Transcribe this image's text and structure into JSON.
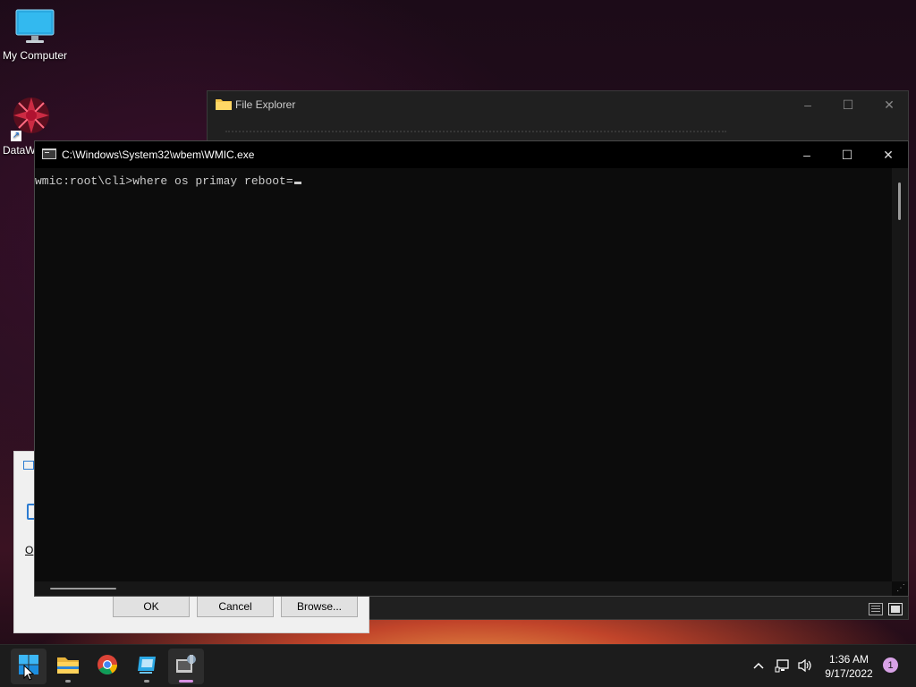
{
  "desktop": {
    "icons": [
      {
        "label": "My Computer",
        "icon": "monitor-icon"
      },
      {
        "label": "DataW",
        "icon": "datawave-app-icon"
      }
    ]
  },
  "file_explorer": {
    "title": "File Explorer",
    "controls": {
      "minimize": "–",
      "maximize": "☐",
      "close": "✕"
    }
  },
  "dialog": {
    "partial_text": "O",
    "buttons": {
      "ok": "OK",
      "cancel": "Cancel",
      "browse": "Browse..."
    }
  },
  "console": {
    "title": "C:\\Windows\\System32\\wbem\\WMIC.exe",
    "controls": {
      "minimize": "–",
      "maximize": "☐",
      "close": "✕"
    },
    "prompt": "wmic:root\\cli>",
    "command": "where os primay reboot="
  },
  "taskbar": {
    "apps": [
      {
        "name": "start",
        "icon": "windows-start-icon"
      },
      {
        "name": "file-explorer",
        "icon": "folder-icon"
      },
      {
        "name": "chrome",
        "icon": "chrome-icon"
      },
      {
        "name": "app",
        "icon": "remote-app-icon"
      },
      {
        "name": "wmic",
        "icon": "wmic-console-icon"
      }
    ],
    "clock": {
      "time": "1:36 AM",
      "date": "9/17/2022"
    },
    "notification_count": "1"
  },
  "colors": {
    "console_bg": "#0c0c0c",
    "console_text": "#cccccc",
    "taskbar_bg": "#1c1c1c",
    "accent": "#d891e3"
  }
}
